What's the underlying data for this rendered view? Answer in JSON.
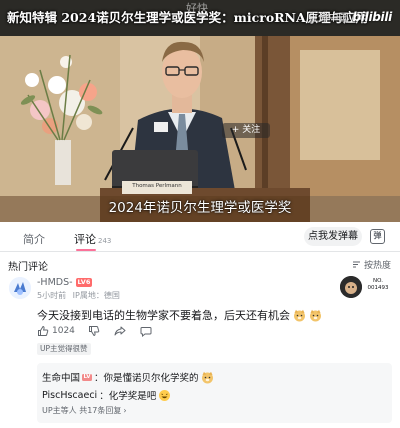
{
  "video": {
    "title": "新知特辑 2024诺贝尔生理学或医学奖：microRNA原理与应用",
    "top_center_text": "好快",
    "brand_text": "生命中国",
    "brand_logo": "bilibili",
    "follow_label": "+ 关注",
    "nameplate": "Thomas Perlmann",
    "caption": "2024年诺贝尔生理学或医学奖"
  },
  "tabs": {
    "intro_label": "简介",
    "comments_label": "评论",
    "comments_count": "243",
    "danmaku_button": "点我发弹幕",
    "danmaku_icon": "弹"
  },
  "comments_header": {
    "hot_label": "热门评论",
    "sort_label": "按热度"
  },
  "comment": {
    "username": "-HMDS-",
    "level": "LV6",
    "time": "5小时前",
    "ip_location": "IP属地：德国",
    "text": "今天没接到电话的生物学家不要着急，后天还有机会",
    "likes": "1024",
    "badge_id": "NO. 001493",
    "up_tag": "UP主觉得很赞",
    "accent_color": "#fb7299"
  },
  "replies": {
    "reply1_user": "生命中国",
    "reply1_level": "LV",
    "reply1_text": "：你是懂诺贝尔化学奖的",
    "reply2_user": "PiscHscaeci",
    "reply2_text": "：化学奖是吧",
    "summary": "UP主等人  共17条回复"
  }
}
